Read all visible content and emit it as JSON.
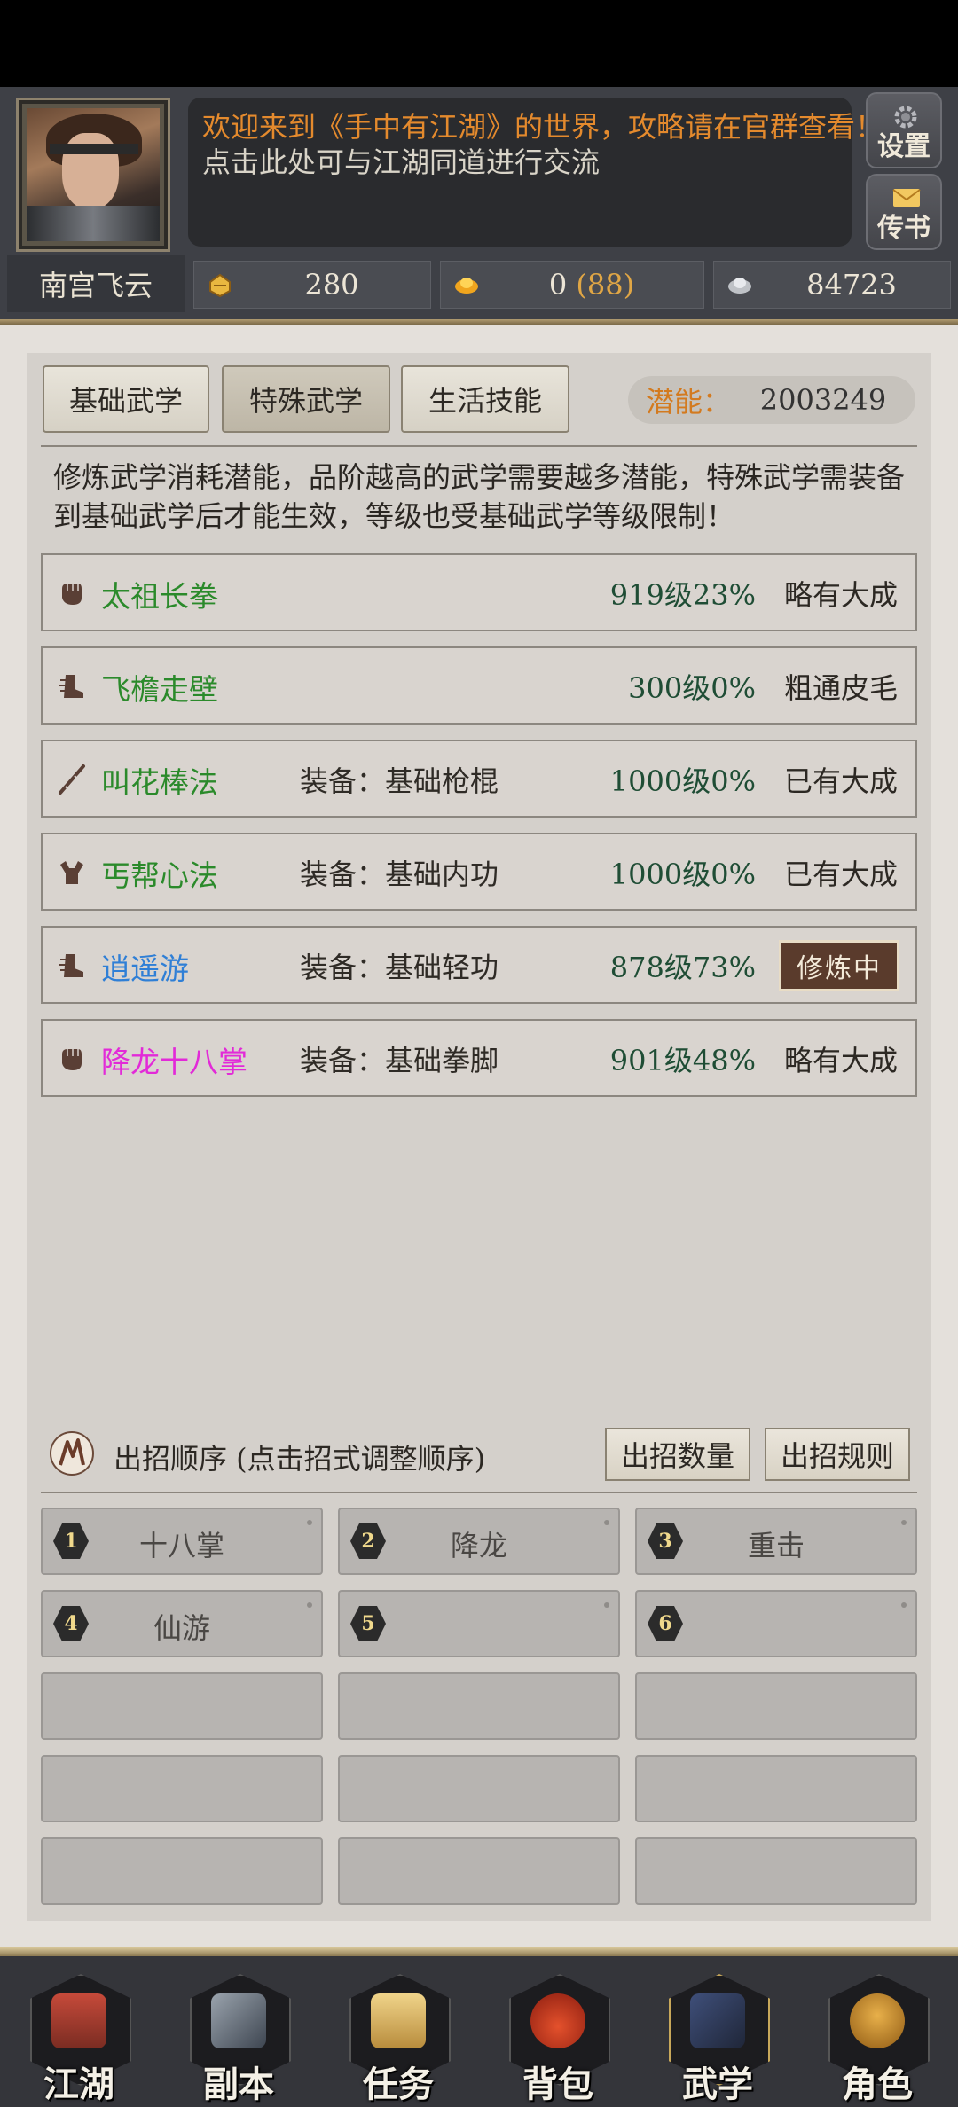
{
  "header": {
    "notice_line1": "欢迎来到《手中有江湖》的世界，攻略请在官群查看！",
    "notice_line2": "点击此处可与江湖同道进行交流",
    "settings_label": "设置",
    "mail_label": "传书",
    "player_name": "南宫飞云",
    "currencies": {
      "ingot": "280",
      "gold": "0",
      "gold_bonus": "(88)",
      "silver": "84723"
    }
  },
  "tabs": [
    "基础武学",
    "特殊武学",
    "生活技能"
  ],
  "potential": {
    "label": "潜能：",
    "value": "2003249"
  },
  "description": "修炼武学消耗潜能，品阶越高的武学需要越多潜能，特殊武学需装备到基础武学后才能生效，等级也受基础武学等级限制！",
  "skills": [
    {
      "name": "太祖长拳",
      "icon": "fist-icon",
      "equip": "",
      "level": "919级23%",
      "stage": "略有大成",
      "color": "green"
    },
    {
      "name": "飞檐走壁",
      "icon": "boot-icon",
      "equip": "",
      "level": "300级0%",
      "stage": "粗通皮毛",
      "color": "green"
    },
    {
      "name": "叫花棒法",
      "icon": "staff-icon",
      "equip": "装备：基础枪棍",
      "level": "1000级0%",
      "stage": "已有大成",
      "color": "green"
    },
    {
      "name": "丐帮心法",
      "icon": "muscle-icon",
      "equip": "装备：基础内功",
      "level": "1000级0%",
      "stage": "已有大成",
      "color": "green"
    },
    {
      "name": "逍遥游",
      "icon": "boot-icon",
      "equip": "装备：基础轻功",
      "level": "878级73%",
      "stage": "修炼中",
      "color": "blue"
    },
    {
      "name": "降龙十八掌",
      "icon": "fist-icon",
      "equip": "装备：基础拳脚",
      "level": "901级48%",
      "stage": "略有大成",
      "color": "pink"
    }
  ],
  "order": {
    "title": "出招顺序 (点击招式调整顺序)",
    "count_button": "出招数量",
    "rules_button": "出招规则",
    "slots": [
      {
        "num": "1",
        "label": "十八掌"
      },
      {
        "num": "2",
        "label": "降龙"
      },
      {
        "num": "3",
        "label": "重击"
      },
      {
        "num": "4",
        "label": "仙游"
      },
      {
        "num": "5",
        "label": ""
      },
      {
        "num": "6",
        "label": ""
      }
    ]
  },
  "nav": [
    "江湖",
    "副本",
    "任务",
    "背包",
    "武学",
    "角色"
  ],
  "colors": {
    "green": "#2b8a2b",
    "blue": "#2f7fd6",
    "pink": "#e22ad8",
    "orange": "#e48a2d"
  }
}
